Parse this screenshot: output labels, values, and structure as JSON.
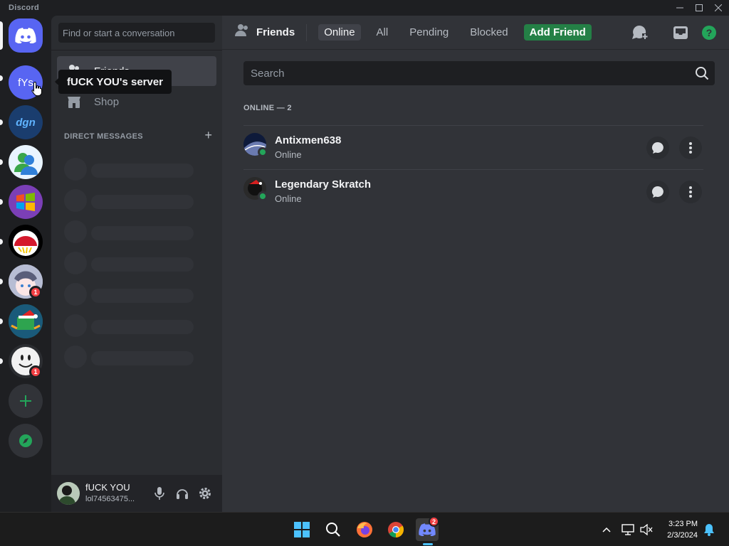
{
  "window": {
    "title": "Discord"
  },
  "servers": [
    {
      "name": "Home",
      "icon": "discord-logo-icon",
      "color": "#5865f2"
    },
    {
      "name": "fUCK YOU's server",
      "acronym": "fYs",
      "color": "#5865f2"
    },
    {
      "name": "dgn server",
      "acronym": "dgn",
      "color": "#1a3d6e"
    },
    {
      "name": "messenger server",
      "icon": "messenger-people-icon"
    },
    {
      "name": "windows server",
      "icon": "windows-logo-icon"
    },
    {
      "name": "ball server",
      "icon": "ball-icon"
    },
    {
      "name": "anime server",
      "badge": "1"
    },
    {
      "name": "christmas server",
      "icon": "santa-hat-icon"
    },
    {
      "name": "face server",
      "badge": "1"
    }
  ],
  "tooltip": {
    "text": "fUCK YOU's server"
  },
  "sidebar": {
    "search_placeholder": "Find or start a conversation",
    "nav": [
      {
        "label": "Friends",
        "icon": "friends-icon"
      },
      {
        "label": "Shop",
        "icon": "shop-icon"
      }
    ],
    "dm_header": "DIRECT MESSAGES",
    "dm_add": "+"
  },
  "user": {
    "name": "fUCK YOU",
    "tag": "lol74563475..."
  },
  "topbar": {
    "title": "Friends",
    "tabs": [
      "Online",
      "All",
      "Pending",
      "Blocked"
    ],
    "add_friend": "Add Friend"
  },
  "friends_search_placeholder": "Search",
  "online_header": "ONLINE — 2",
  "friends": [
    {
      "name": "Antixmen638",
      "status": "Online"
    },
    {
      "name": "Legendary Skratch",
      "status": "Online"
    }
  ],
  "taskbar": {
    "discord_badge": "2",
    "time": "3:23 PM",
    "date": "2/3/2024"
  },
  "colors": {
    "blurple": "#5865f2",
    "green": "#248046",
    "online": "#23a55a",
    "badge": "#f23f43"
  }
}
